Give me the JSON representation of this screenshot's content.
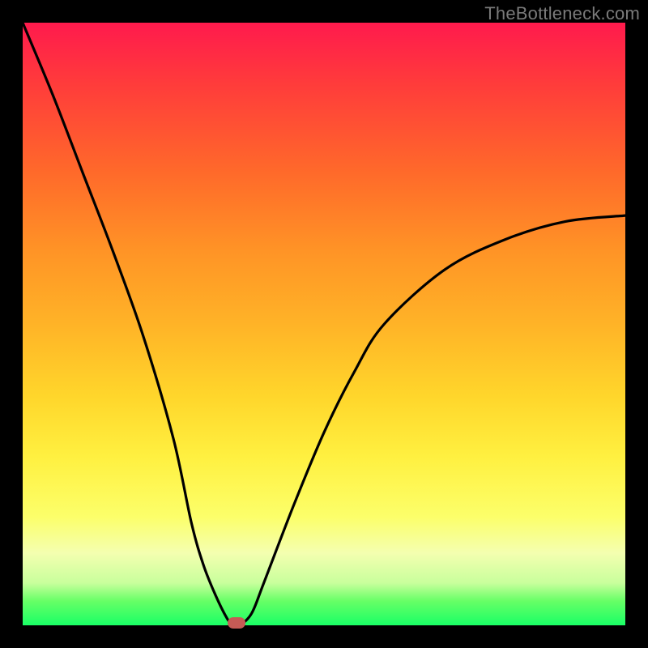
{
  "watermark": "TheBottleneck.com",
  "chart_data": {
    "type": "line",
    "title": "",
    "xlabel": "",
    "ylabel": "",
    "ylim": [
      0,
      100
    ],
    "series": [
      {
        "name": "bottleneck-curve",
        "x": [
          0,
          5,
          10,
          15,
          20,
          25,
          28,
          30,
          32,
          34,
          35,
          36,
          38,
          40,
          45,
          50,
          55,
          60,
          70,
          80,
          90,
          100
        ],
        "values": [
          100,
          88,
          75,
          62,
          48,
          31,
          17,
          10,
          5,
          1,
          0,
          0,
          2,
          7,
          20,
          32,
          42,
          50,
          59,
          64,
          67,
          68
        ]
      }
    ],
    "marker": {
      "x": 35.5,
      "y": 0
    },
    "background_gradient": [
      "#ff1a4d",
      "#ffd62b",
      "#1aff66"
    ]
  }
}
